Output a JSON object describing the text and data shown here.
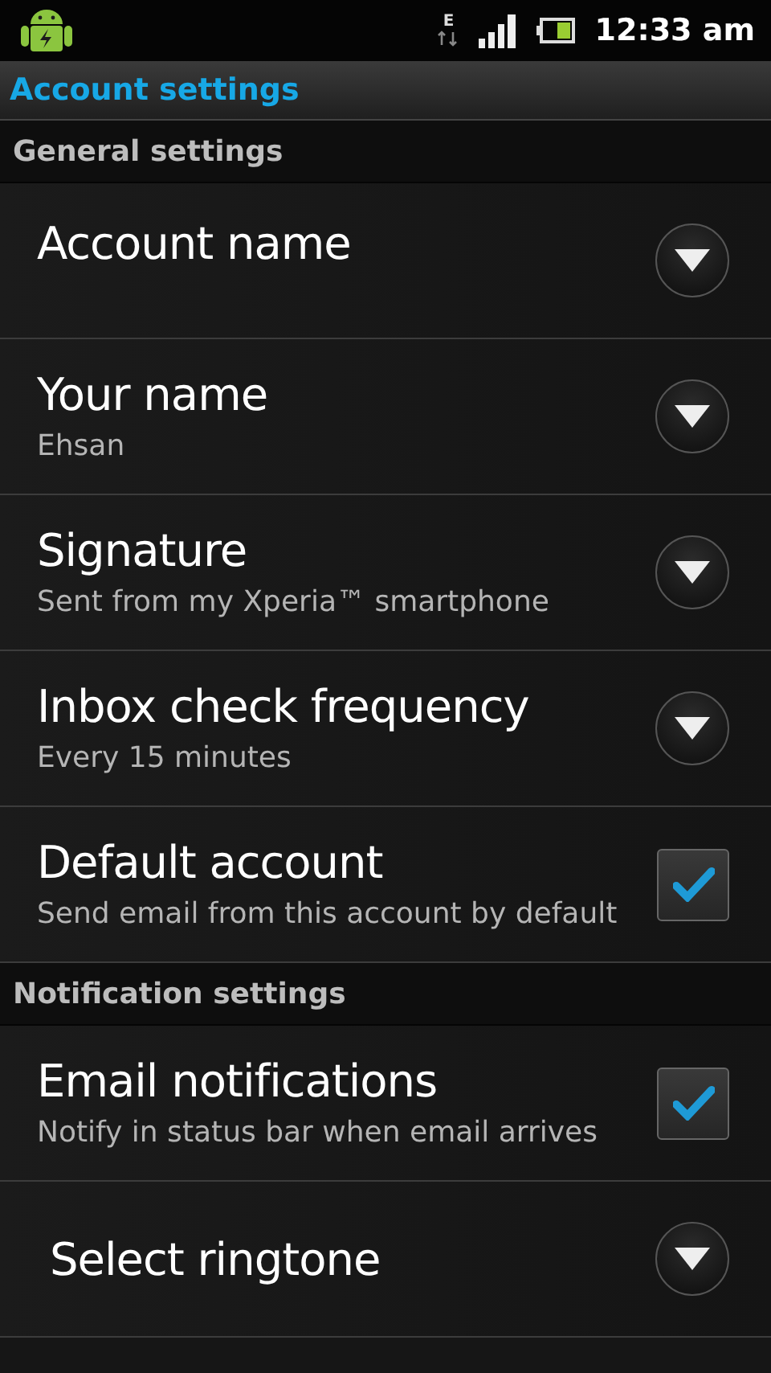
{
  "status_bar": {
    "network_type": "E",
    "time": "12:33 am"
  },
  "title": "Account settings",
  "sections": [
    {
      "title": "General settings",
      "items": [
        {
          "kind": "dropdown",
          "title": "Account name"
        },
        {
          "kind": "dropdown",
          "title": "Your name",
          "summary": "Ehsan"
        },
        {
          "kind": "dropdown",
          "title": "Signature",
          "summary": "Sent from my Xperia™ smartphone"
        },
        {
          "kind": "dropdown",
          "title": "Inbox check frequency",
          "summary": "Every 15 minutes"
        },
        {
          "kind": "checkbox",
          "title": "Default account",
          "summary": "Send email from this account by default",
          "checked": true
        }
      ]
    },
    {
      "title": "Notification settings",
      "items": [
        {
          "kind": "checkbox",
          "title": "Email notifications",
          "summary": "Notify in status bar when email arrives",
          "checked": true
        },
        {
          "kind": "dropdown",
          "title": "Select ringtone"
        }
      ]
    }
  ]
}
